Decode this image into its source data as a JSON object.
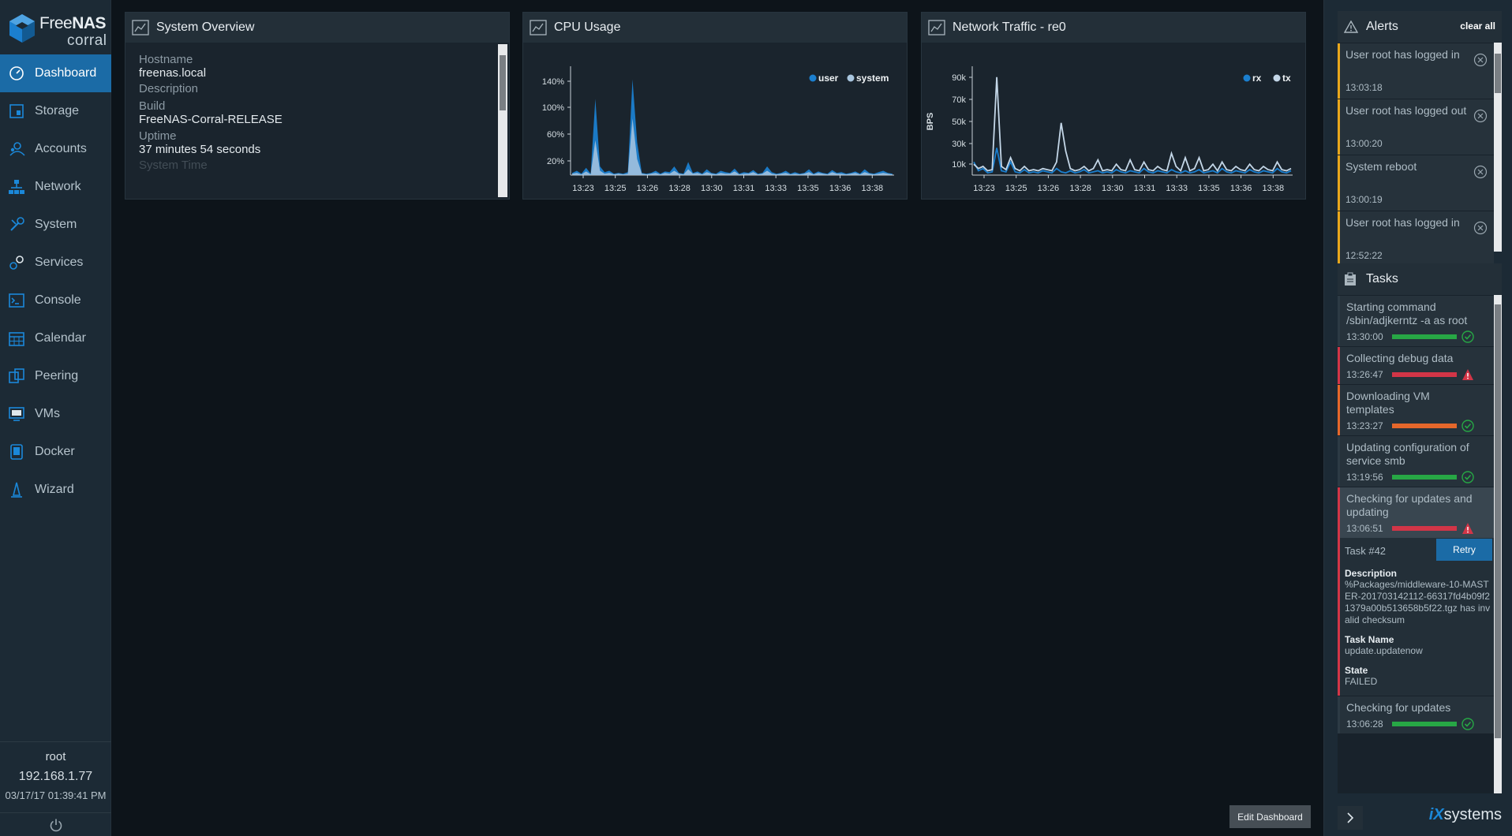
{
  "brand": {
    "name_light": "Free",
    "name_bold": "NAS",
    "sub": "corral"
  },
  "nav": [
    {
      "label": "Dashboard",
      "icon": "dashboard-icon",
      "active": true
    },
    {
      "label": "Storage",
      "icon": "storage-icon"
    },
    {
      "label": "Accounts",
      "icon": "accounts-icon"
    },
    {
      "label": "Network",
      "icon": "network-icon"
    },
    {
      "label": "System",
      "icon": "system-icon"
    },
    {
      "label": "Services",
      "icon": "services-icon"
    },
    {
      "label": "Console",
      "icon": "console-icon"
    },
    {
      "label": "Calendar",
      "icon": "calendar-icon"
    },
    {
      "label": "Peering",
      "icon": "peering-icon"
    },
    {
      "label": "VMs",
      "icon": "vms-icon"
    },
    {
      "label": "Docker",
      "icon": "docker-icon"
    },
    {
      "label": "Wizard",
      "icon": "wizard-icon"
    }
  ],
  "session": {
    "user": "root",
    "ip": "192.168.1.77",
    "datetime": "03/17/17 01:39:41 PM"
  },
  "overview": {
    "title": "System Overview",
    "rows": [
      {
        "label": "Hostname",
        "value": "freenas.local"
      },
      {
        "label": "Description",
        "value": ""
      },
      {
        "label": "Build",
        "value": "FreeNAS-Corral-RELEASE"
      },
      {
        "label": "Uptime",
        "value": "37 minutes 54 seconds"
      },
      {
        "label": "System Time",
        "value": ""
      }
    ]
  },
  "cpu": {
    "title": "CPU Usage",
    "chart_data": {
      "type": "area",
      "x": [
        "13:23",
        "13:25",
        "13:26",
        "13:28",
        "13:30",
        "13:31",
        "13:33",
        "13:35",
        "13:36",
        "13:38"
      ],
      "yticks": [
        "140%",
        "100%",
        "60%",
        "20%"
      ],
      "series": [
        {
          "name": "user",
          "color": "#1b7fcf",
          "values": [
            3,
            6,
            2,
            10,
            2,
            105,
            12,
            4,
            6,
            2,
            3,
            2,
            4,
            132,
            45,
            3,
            2,
            3,
            6,
            2,
            5,
            4,
            12,
            3,
            2,
            18,
            3,
            5,
            2,
            8,
            3,
            2,
            6,
            4,
            3,
            9,
            2,
            4,
            3,
            7,
            2,
            3,
            12,
            4,
            2,
            3,
            6,
            2,
            4,
            2,
            3,
            8,
            2,
            5,
            3,
            2,
            7,
            3,
            4,
            2,
            3,
            5,
            2,
            8,
            3,
            2,
            4,
            6,
            3,
            2
          ]
        },
        {
          "name": "system",
          "color": "#a9c6df",
          "values": [
            2,
            3,
            1,
            5,
            1,
            48,
            6,
            2,
            3,
            1,
            2,
            1,
            2,
            78,
            22,
            2,
            1,
            2,
            3,
            1,
            3,
            2,
            6,
            2,
            1,
            8,
            2,
            3,
            1,
            4,
            2,
            1,
            3,
            2,
            2,
            5,
            1,
            2,
            2,
            4,
            1,
            2,
            6,
            2,
            1,
            2,
            3,
            1,
            2,
            1,
            2,
            4,
            1,
            3,
            2,
            1,
            4,
            2,
            2,
            1,
            2,
            3,
            1,
            4,
            2,
            1,
            2,
            3,
            2,
            1
          ]
        }
      ]
    }
  },
  "network": {
    "title": "Network Traffic - re0",
    "chart_data": {
      "type": "line",
      "x": [
        "13:23",
        "13:25",
        "13:26",
        "13:28",
        "13:30",
        "13:31",
        "13:33",
        "13:35",
        "13:36",
        "13:38"
      ],
      "yticks": [
        "90k",
        "70k",
        "50k",
        "30k",
        "10k"
      ],
      "ylabel": "BPS",
      "series": [
        {
          "name": "rx",
          "color": "#1b7fcf",
          "values": [
            12,
            4,
            6,
            2,
            3,
            25,
            4,
            3,
            12,
            3,
            2,
            5,
            2,
            3,
            2,
            4,
            3,
            2,
            6,
            3,
            2,
            4,
            2,
            3,
            5,
            2,
            3,
            4,
            2,
            3,
            2,
            5,
            3,
            2,
            4,
            3,
            2,
            6,
            3,
            2,
            4,
            3,
            2,
            5,
            3,
            2,
            4,
            2,
            3,
            5,
            2,
            3,
            4,
            2,
            6,
            3,
            2,
            4,
            3,
            2,
            5,
            3,
            2,
            4,
            3,
            2,
            6,
            3,
            2,
            4
          ]
        },
        {
          "name": "tx",
          "color": "#c4d7e8",
          "values": [
            10,
            6,
            8,
            4,
            5,
            90,
            8,
            5,
            16,
            6,
            4,
            8,
            4,
            5,
            4,
            6,
            5,
            4,
            12,
            48,
            22,
            6,
            4,
            5,
            8,
            4,
            6,
            14,
            4,
            5,
            4,
            10,
            5,
            4,
            14,
            5,
            4,
            12,
            5,
            4,
            8,
            5,
            4,
            20,
            8,
            4,
            16,
            4,
            6,
            16,
            4,
            5,
            10,
            4,
            12,
            5,
            4,
            8,
            5,
            4,
            10,
            5,
            4,
            8,
            5,
            4,
            12,
            5,
            4,
            6
          ]
        }
      ]
    }
  },
  "alerts": {
    "title": "Alerts",
    "clear_label": "clear all",
    "items": [
      {
        "msg": "User root has logged in",
        "time": "13:03:18"
      },
      {
        "msg": "User root has logged out",
        "time": "13:00:20"
      },
      {
        "msg": "System reboot",
        "time": "13:00:19"
      },
      {
        "msg": "User root has logged in",
        "time": "12:52:22"
      }
    ]
  },
  "tasks": {
    "title": "Tasks",
    "items": [
      {
        "msg": "Starting command /sbin/adjkerntz -a as root",
        "time": "13:30:00",
        "status": "ok"
      },
      {
        "msg": "Collecting debug data",
        "time": "13:26:47",
        "status": "failed"
      },
      {
        "msg": "Downloading VM templates",
        "time": "13:23:27",
        "status": "warn"
      },
      {
        "msg": "Updating configuration of service smb",
        "time": "13:19:56",
        "status": "ok"
      },
      {
        "msg": "Checking for updates and updating",
        "time": "13:06:51",
        "status": "failed"
      }
    ],
    "detail": {
      "task_num": "Task #42",
      "retry_label": "Retry",
      "description_label": "Description",
      "description": "%Packages/middleware-10-MASTER-201703142112-66317fd4b09f21379a00b513658b5f22.tgz has invalid checksum",
      "name_label": "Task Name",
      "name": "update.updatenow",
      "state_label": "State",
      "state": "FAILED"
    },
    "last": {
      "msg": "Checking for updates",
      "time": "13:06:28",
      "status": "ok"
    }
  },
  "edit_dashboard_label": "Edit Dashboard",
  "vendor": {
    "prefix": "iX",
    "suffix": "systems"
  },
  "colors": {
    "accent": "#1b6ba6",
    "ok": "#27a745",
    "failed": "#d23547",
    "warn": "#e5672b",
    "alert": "#e8a71c"
  }
}
